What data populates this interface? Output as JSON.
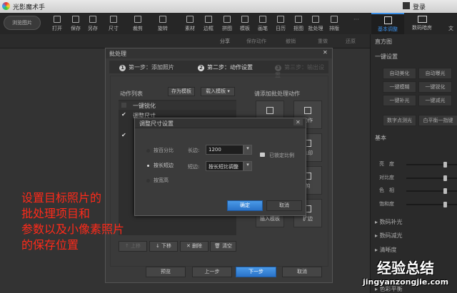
{
  "app": {
    "title": "光影魔术手",
    "login": "登录"
  },
  "toolbar": {
    "browse": "浏览图片",
    "items": [
      "打开",
      "保存",
      "另存",
      "尺寸",
      "裁剪",
      "旋转",
      "素材",
      "边框",
      "拼图",
      "模板",
      "画笔",
      "日历",
      "抠图",
      "批处理",
      "排版"
    ],
    "more": "···"
  },
  "subbar": {
    "share": "分享",
    "save_action": "保存动作",
    "undo": "撤销",
    "redo": "重做",
    "restore": "还原"
  },
  "right_tabs": [
    "基本调整",
    "数码暗房",
    "文"
  ],
  "right_panel": {
    "histogram": "直方图",
    "one_key": "一键设置",
    "buttons": [
      "自动美化",
      "自动曝光",
      "一键模糊",
      "一键锐化",
      "一键补光",
      "一键减光"
    ],
    "buttons2": [
      "数字点测光",
      "白平衡一指键"
    ],
    "basic": "基本",
    "sliders": [
      {
        "label": "亮　度",
        "value": 0.5
      },
      {
        "label": "对比度",
        "value": 0.5
      },
      {
        "label": "色　相",
        "value": 0.5
      },
      {
        "label": "饱和度",
        "value": 0.5
      }
    ],
    "sections": [
      "数码补光",
      "数码减光",
      "清晰度",
      "色彩平衡"
    ]
  },
  "batch": {
    "title": "批处理",
    "steps": [
      "第一步：添加照片",
      "第二步：动作设置",
      "第三步：输出设置"
    ],
    "step_nums": [
      "1",
      "2",
      "3"
    ],
    "list_label": "动作列表",
    "save_tpl": "存为模板",
    "load_tpl": "载入模板",
    "items": [
      {
        "label": "一键锐化",
        "checked": false
      },
      {
        "label": "调整尺寸",
        "checked": true
      }
    ],
    "add_label": "请添加批处理动作",
    "tiles": [
      "",
      "动作",
      "",
      "水印",
      "",
      "剪",
      "插入模板",
      "扩边"
    ],
    "move_up": "上移",
    "move_down": "下移",
    "delete": "删除",
    "clear": "清空",
    "preview": "预览",
    "prev": "上一步",
    "next": "下一步",
    "cancel": "取消"
  },
  "resize": {
    "title": "调整尺寸设置",
    "options": [
      "按百分比",
      "按长短边",
      "按宽高"
    ],
    "long_label": "长边:",
    "long_value": "1200",
    "short_label": "短边:",
    "short_value": "按长短比调整",
    "lock": "已锁定比例",
    "ok": "确定",
    "cancel": "取消"
  },
  "annotation": [
    "设置目标照片的",
    "批处理项目和",
    "参数以及小像素照片",
    "的保存位置"
  ],
  "watermark": {
    "text": "经验总结",
    "url": "jingyanzongjie.com"
  }
}
